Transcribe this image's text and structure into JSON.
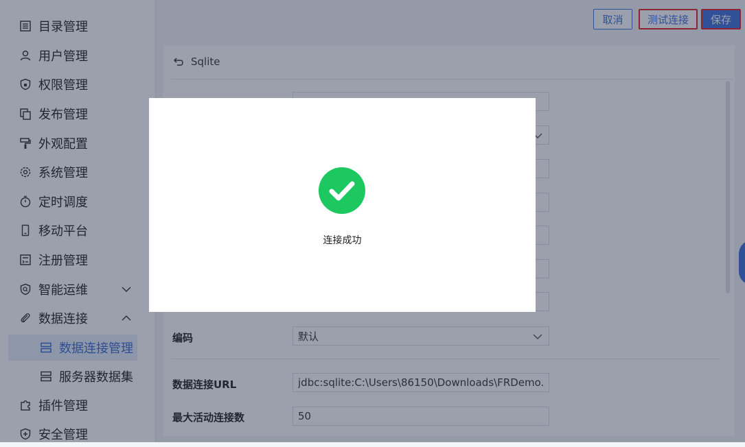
{
  "sidebar": {
    "items": [
      {
        "label": "目录管理",
        "icon": "catalog-icon"
      },
      {
        "label": "用户管理",
        "icon": "user-icon"
      },
      {
        "label": "权限管理",
        "icon": "shield-lock-icon"
      },
      {
        "label": "发布管理",
        "icon": "copy-icon"
      },
      {
        "label": "外观配置",
        "icon": "paint-roller-icon"
      },
      {
        "label": "系统管理",
        "icon": "gear-icon"
      },
      {
        "label": "定时调度",
        "icon": "stopwatch-icon"
      },
      {
        "label": "移动平台",
        "icon": "mobile-icon"
      },
      {
        "label": "注册管理",
        "icon": "register-icon"
      },
      {
        "label": "智能运维",
        "icon": "shield-search-icon"
      },
      {
        "label": "数据连接",
        "icon": "paperclip-icon"
      },
      {
        "label": "插件管理",
        "icon": "puzzle-icon"
      },
      {
        "label": "安全管理",
        "icon": "shield-plus-icon"
      }
    ],
    "sub_items": [
      {
        "label": "数据连接管理",
        "icon": "database-icon"
      },
      {
        "label": "服务器数据集",
        "icon": "database-icon"
      }
    ]
  },
  "toolbar": {
    "cancel_label": "取消",
    "test_label": "测试连接",
    "save_label": "保存"
  },
  "panel": {
    "title": "Sqlite",
    "fields": {
      "encoding_label": "编码",
      "encoding_value": "默认",
      "url_label": "数据连接URL",
      "url_value": "jdbc:sqlite:C:\\Users\\86150\\Downloads\\FRDemo....",
      "max_active_label": "最大活动连接数",
      "max_active_value": "50"
    }
  },
  "modal": {
    "message": "连接成功",
    "icon": "success-check-icon"
  },
  "colors": {
    "accent": "#3d6fd9",
    "success": "#1ec860",
    "highlight_border": "#e02020"
  }
}
